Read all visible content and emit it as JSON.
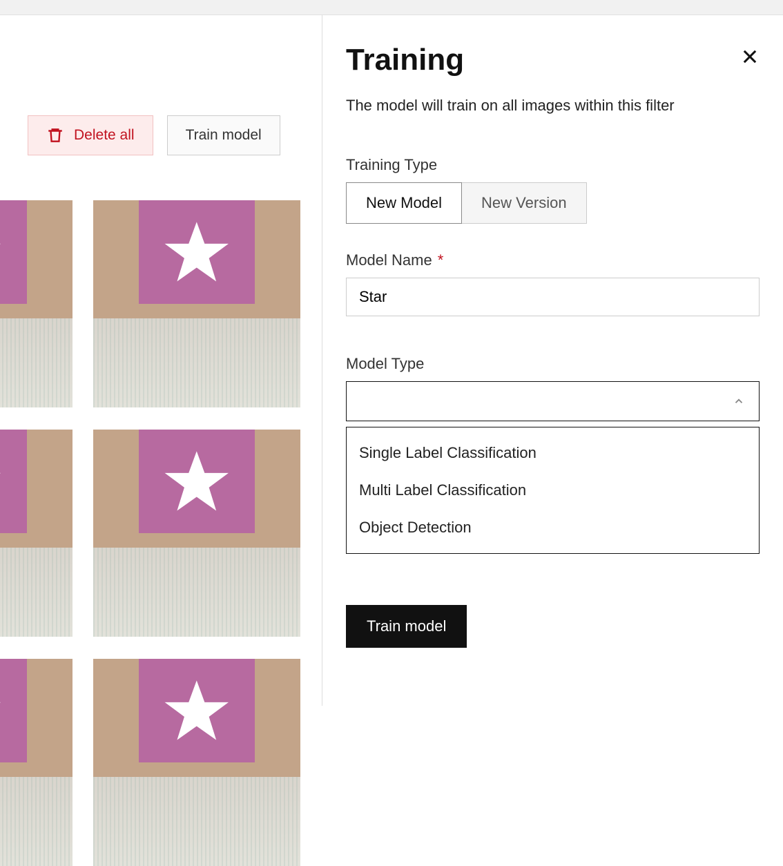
{
  "left": {
    "delete_label": "Delete all",
    "train_label": "Train model"
  },
  "panel": {
    "title": "Training",
    "description": "The model will train on all images within this filter",
    "training_type_label": "Training Type",
    "training_type_options": {
      "new_model": "New Model",
      "new_version": "New Version"
    },
    "model_name_label": "Model Name",
    "model_name_value": "Star",
    "model_type_label": "Model Type",
    "model_type_options": {
      "single": "Single Label Classification",
      "multi": "Multi Label Classification",
      "object": "Object Detection"
    },
    "submit_label": "Train model"
  },
  "colors": {
    "danger": "#c1121f",
    "accent_bg": "#fdecec"
  }
}
